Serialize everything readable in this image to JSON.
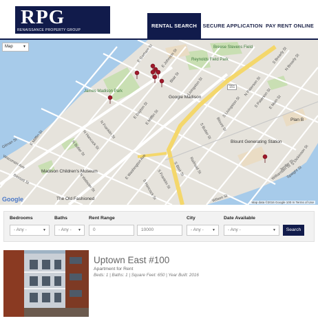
{
  "brand": {
    "name": "RPG",
    "subtitle": "RENAISSANCE PROPERTY GROUP"
  },
  "nav": {
    "items": [
      {
        "label": "RENTAL SEARCH",
        "active": true
      },
      {
        "label": "SECURE APPLICATION",
        "active": false
      },
      {
        "label": "PAY RENT ONLINE",
        "active": false
      }
    ]
  },
  "colors": {
    "brand_navy": "#111b4b",
    "pin_red": "#a0182a",
    "water": "#a7cbea",
    "park": "#c9dfb3",
    "highway": "#f4d76b"
  },
  "map": {
    "type_selector": "Map",
    "streets": [
      "E Gorham St",
      "E Johnson St",
      "Blair St",
      "Livingston St",
      "E Dayton St",
      "N Franklin St",
      "N Hancock St",
      "E Mifflin St",
      "N Butler St",
      "E Washington Ave",
      "S Blair St",
      "N Webster St",
      "S Franklin St",
      "S Hancock St",
      "S Butler St",
      "Railroad St",
      "Wilson St",
      "N Paterson St",
      "S Paterson St",
      "E Main St",
      "Williamson St",
      "Jenifer St",
      "Spaight St",
      "S Dickinson St",
      "Gilman St",
      "Wisconsin Ave",
      "Bassett St",
      "E Mifflin St",
      "S Brearly St",
      "N Brearly St",
      "Blount St",
      "S Livingston St",
      "Plan B",
      "151"
    ],
    "places": [
      {
        "name": "Google Madison"
      },
      {
        "name": "Blount Generating Station"
      },
      {
        "name": "Madison Children's Museum"
      },
      {
        "name": "The Old Fashioned"
      },
      {
        "name": "Plan B"
      }
    ],
    "parks": [
      {
        "name": "James Madison Park"
      },
      {
        "name": "Breese Stevens Field"
      },
      {
        "name": "Reynolds Field Park"
      }
    ],
    "pin_count": 9,
    "attribution": "Map data ©2016 Google    100 m    Terms of Use",
    "google": "Google"
  },
  "search": {
    "bedrooms": {
      "label": "Bedrooms",
      "value": "- Any -"
    },
    "baths": {
      "label": "Baths",
      "value": "- Any -"
    },
    "rent_range": {
      "label": "Rent Range",
      "min": "0",
      "max": "10000"
    },
    "city": {
      "label": "City",
      "value": "- Any -"
    },
    "date_available": {
      "label": "Date Available",
      "value": "- Any -"
    },
    "button": "Search"
  },
  "listing": {
    "title": "Uptown East #100",
    "type": "Apartment for Rent",
    "details": "Beds: 1 | Baths: 1 | Square Feet: 650 | Year Built: 2016"
  }
}
